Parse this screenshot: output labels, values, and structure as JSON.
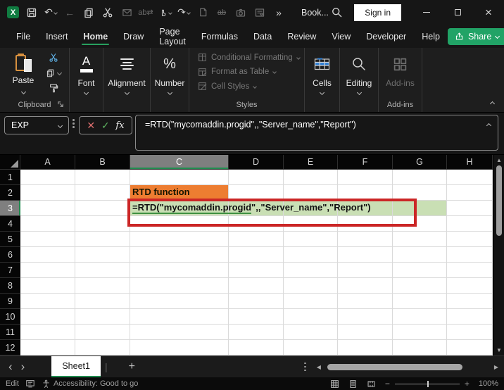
{
  "titlebar": {
    "title": "Book...",
    "sign_in": "Sign in",
    "more_commands": "»",
    "icons": [
      "excel-logo",
      "save",
      "undo",
      "back",
      "copy",
      "cut",
      "mail",
      "translate",
      "touch-mode",
      "redo",
      "new-file",
      "strikethrough",
      "camera",
      "name-manager",
      "more-commands",
      "search",
      "minimize",
      "maximize",
      "close"
    ]
  },
  "menubar": {
    "tabs": [
      "File",
      "Insert",
      "Home",
      "Draw",
      "Page Layout",
      "Formulas",
      "Data",
      "Review",
      "View",
      "Developer",
      "Help"
    ],
    "active_tab": "Home",
    "share_label": "Share"
  },
  "ribbon": {
    "paste_label": "Paste",
    "clipboard_group_label": "Clipboard",
    "font_label": "Font",
    "alignment_label": "Alignment",
    "number_label": "Number",
    "styles_items": [
      "Conditional Formatting",
      "Format as Table",
      "Cell Styles"
    ],
    "styles_group_label": "Styles",
    "cells_label": "Cells",
    "editing_label": "Editing",
    "addins_label": "Add-ins",
    "addins_group_label": "Add-ins"
  },
  "formula_bar": {
    "name_box_value": "EXP",
    "formula": "=RTD(\"mycomaddin.progid\",,\"Server_name\",\"Report\")"
  },
  "grid": {
    "columns": [
      "A",
      "B",
      "C",
      "D",
      "E",
      "F",
      "G",
      "H"
    ],
    "rows": [
      "1",
      "2",
      "3",
      "4",
      "5",
      "6",
      "7",
      "8",
      "9",
      "10",
      "11",
      "12"
    ],
    "selected_column": "C",
    "selected_row": "3",
    "cells": {
      "c2": {
        "text": "RTD function",
        "bg": "#ED7D31"
      },
      "c3": {
        "formula_part1": "=RTD(\"mycomaddin.progid",
        "formula_part2": "\",,\"Server_name\",\"Report\")",
        "bg": "#C9DFB4"
      }
    },
    "colors": {
      "annotation_border": "#CB2626",
      "orange_fill": "#ED7D31",
      "green_fill": "#C9DFB4",
      "formula_underline": "#3F9142",
      "selection_accent": "#1F8A4E"
    }
  },
  "sheet_bar": {
    "tabs": [
      {
        "label": "Sheet1",
        "active": true
      }
    ],
    "add_label": "+"
  },
  "status_bar": {
    "mode": "Edit",
    "accessibility": "Accessibility: Good to go",
    "zoom_level": "100%"
  }
}
